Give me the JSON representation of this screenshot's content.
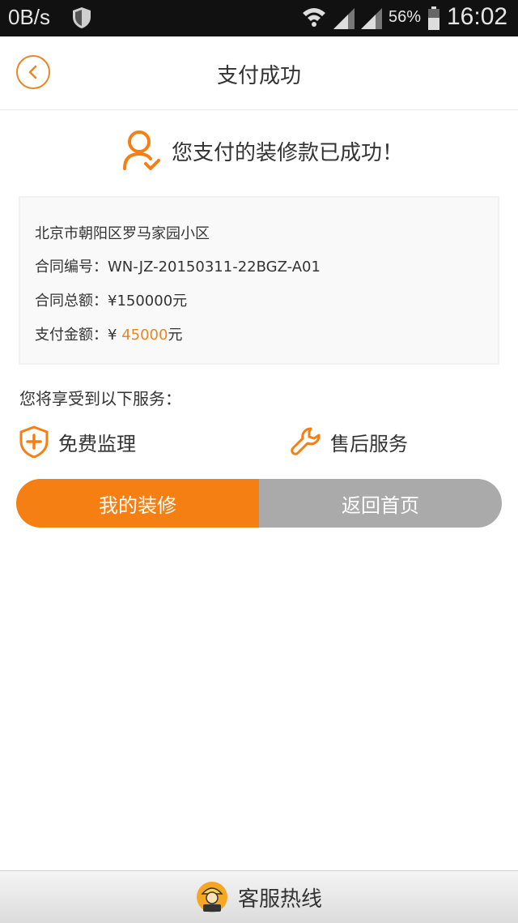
{
  "statusbar": {
    "speed": "0B/s",
    "battery_pct": "56%",
    "time": "16:02"
  },
  "header": {
    "title": "支付成功"
  },
  "success": {
    "message": "您支付的装修款已成功！"
  },
  "order": {
    "address": "北京市朝阳区罗马家园小区",
    "contract_no_label": "合同编号：",
    "contract_no": "WN-JZ-20150311-22BGZ-A01",
    "contract_total_label": "合同总额：",
    "contract_total": "¥150000元",
    "paid_label": "支付金额：",
    "paid_currency": "¥",
    "paid_amount": "45000",
    "paid_unit": "元"
  },
  "services": {
    "title": "您将享受到以下服务：",
    "items": [
      {
        "label": "免费监理",
        "icon": "shield-plus-icon"
      },
      {
        "label": "售后服务",
        "icon": "wrench-icon"
      }
    ]
  },
  "buttons": {
    "my_decoration": "我的装修",
    "back_home": "返回首页"
  },
  "footer": {
    "label": "客服热线"
  },
  "colors": {
    "accent": "#ea8625",
    "button_primary": "#f57f12",
    "button_secondary": "#aaaaaa",
    "text": "#333333",
    "box_bg": "#f9f9f9",
    "box_border": "#f1f1f1"
  }
}
